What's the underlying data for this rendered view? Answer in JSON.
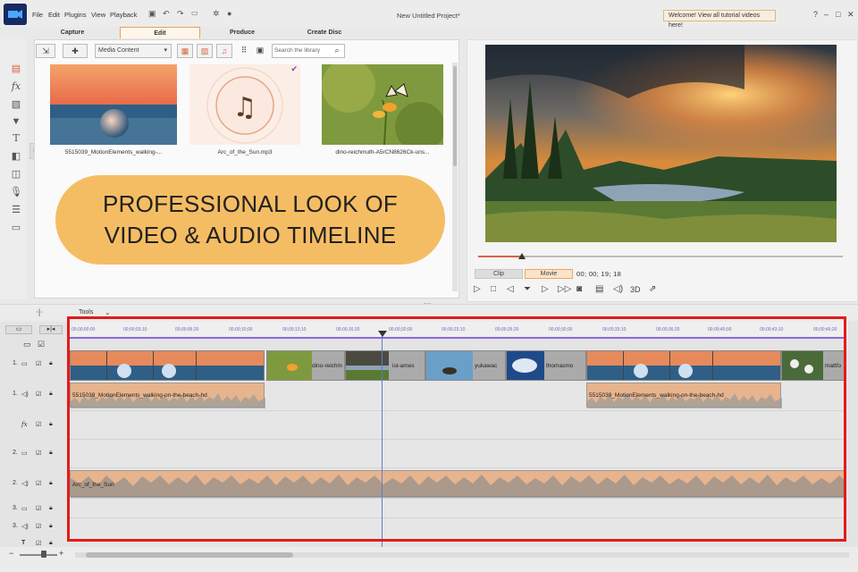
{
  "window": {
    "project_title": "New Untitled Project*",
    "welcome_text": "Welcome! View all tutorial videos here!",
    "menu": [
      "File",
      "Edit",
      "Plugins",
      "View",
      "Playback"
    ],
    "help": "?",
    "minimize": "–",
    "maximize": "□",
    "close": "✕"
  },
  "modes": {
    "capture": "Capture",
    "edit": "Edit",
    "produce": "Produce",
    "create_disc": "Create Disc"
  },
  "library": {
    "dropdown": "Media Content",
    "search_placeholder": "Search the library",
    "items": [
      {
        "caption": "5515039_MotionElements_walking-...",
        "kind": "video"
      },
      {
        "caption": "Arc_of_the_Sun.mp3",
        "kind": "audio"
      },
      {
        "caption": "dino-reichmuth-A5rCN8626Ck-uns...",
        "kind": "image"
      }
    ]
  },
  "banner": {
    "line1": "PROFESSIONAL LOOK OF",
    "line2": "VIDEO & AUDIO TIMELINE"
  },
  "preview": {
    "clip_tab": "Clip",
    "movie_tab": "Movie",
    "timecode": "00; 00; 19; 18",
    "playhead_fraction": 0.12,
    "threed_label": "3D"
  },
  "timeline": {
    "tools_label": "Tools",
    "ruler": [
      "00;00;00;00",
      "00;00;03;10",
      "00;00;06;20",
      "00;00;10;00",
      "00;00;13;10",
      "00;00;16;20",
      "00;00;20;00",
      "00;00;23;10",
      "00;00;26;20",
      "00;00;30;00",
      "00;00;33;10",
      "00;00;36;20",
      "00;00;40;00",
      "00;00;43;10",
      "00;00;46;20"
    ],
    "tracks": [
      {
        "label": "1."
      },
      {
        "label": "1."
      },
      {
        "label": "fx"
      },
      {
        "label": "2."
      },
      {
        "label": "2."
      },
      {
        "label": "3."
      },
      {
        "label": "3."
      },
      {
        "label": "T"
      }
    ],
    "video_clip_labels": [
      "dino-reichm",
      "ist-ames",
      "yukawac",
      "thomasmo",
      "mattfo"
    ],
    "audio_clip_1": "5515039_MotionElements_walking-on-the-beach-hd",
    "audio_clip_2": "5515039_MotionElements_walking-on-the-beach-hd",
    "music_clip": "Arc_of_the_Sun"
  }
}
